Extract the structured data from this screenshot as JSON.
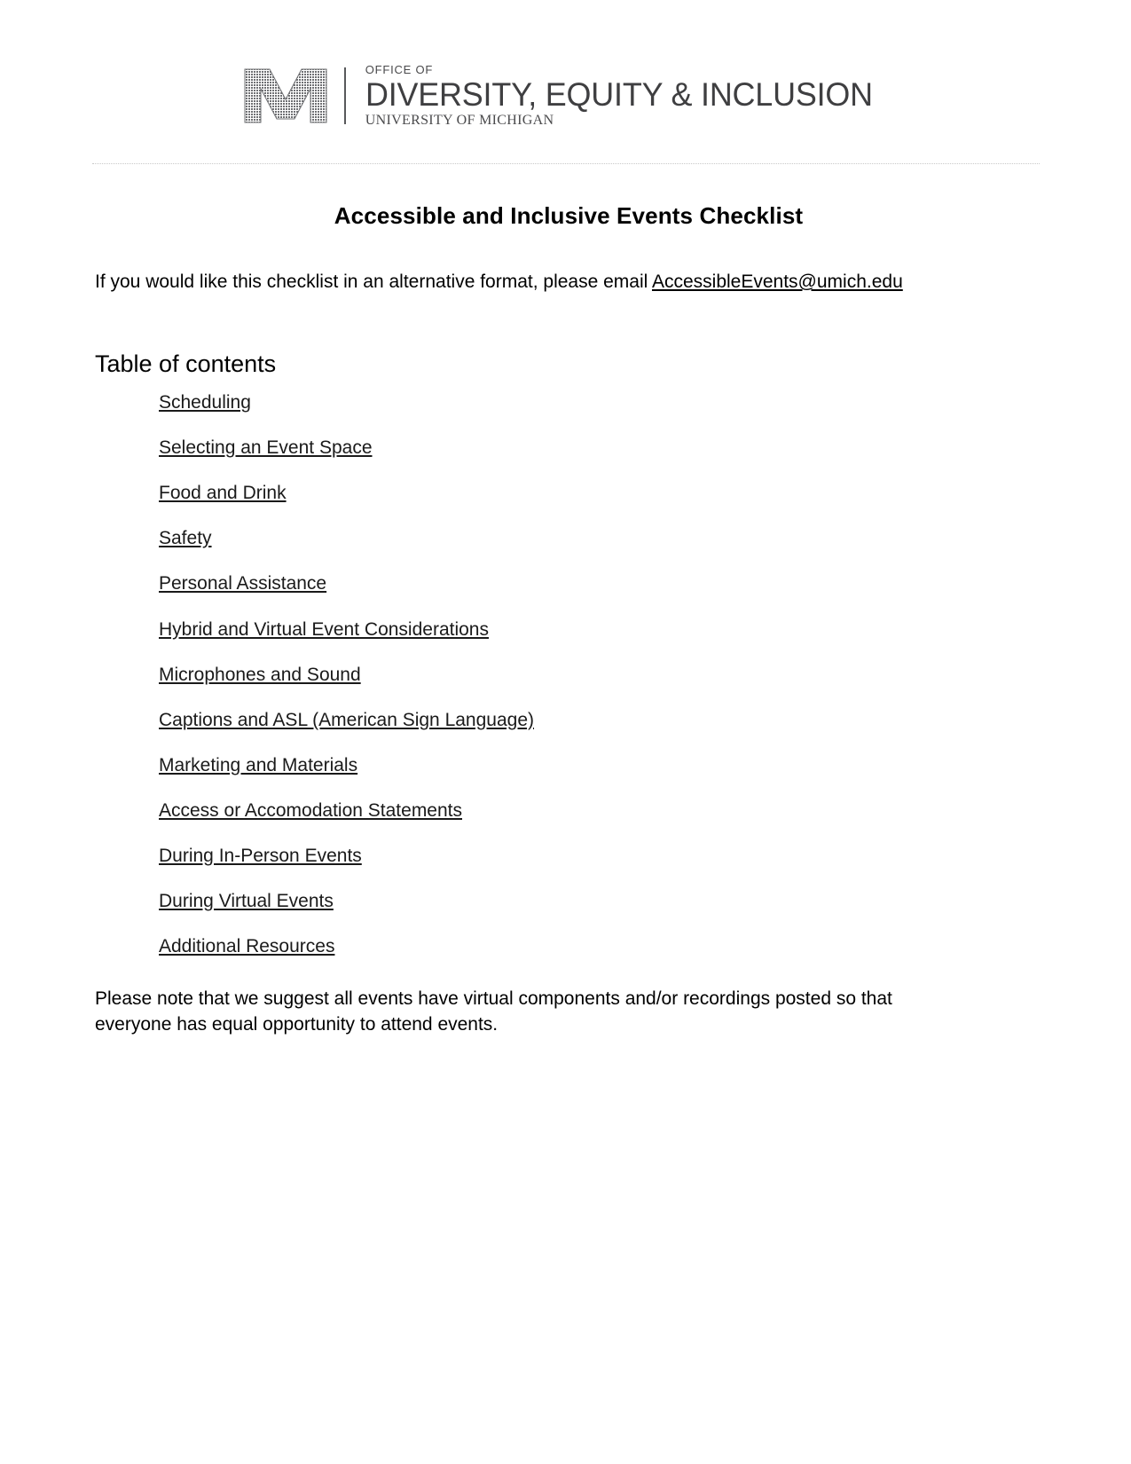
{
  "logo": {
    "mark_name": "block-m-logo",
    "eyebrow": "OFFICE OF",
    "main": "DIVERSITY, EQUITY & INCLUSION",
    "sub": "UNIVERSITY OF MICHIGAN"
  },
  "document": {
    "title": "Accessible and Inclusive Events Checklist",
    "intro_prefix": "If you would like this checklist in an alternative format, please email ",
    "intro_email": "AccessibleEvents@umich.edu",
    "toc_heading": "Table of contents",
    "toc_items": [
      {
        "label": "Scheduling"
      },
      {
        "label": "Selecting an Event Space"
      },
      {
        "label": "Food and Drink"
      },
      {
        "label": "Safety"
      },
      {
        "label": "Personal Assistance"
      },
      {
        "label": "Hybrid and Virtual Event Considerations"
      },
      {
        "label": "Microphones and Sound"
      },
      {
        "label": "Captions and ASL (American Sign Language)"
      },
      {
        "label": "Marketing and Materials"
      },
      {
        "label": "Access or Accomodation Statements"
      },
      {
        "label": "During In-Person Events"
      },
      {
        "label": "During Virtual Events"
      },
      {
        "label": "Additional Resources"
      }
    ],
    "closing_note": "Please note that we suggest all events have virtual components and/or recordings posted so that everyone has equal opportunity to attend events."
  },
  "colors": {
    "text": "#000000",
    "logo_gray": "#3f3f41",
    "rule": "#c9c9c9"
  }
}
